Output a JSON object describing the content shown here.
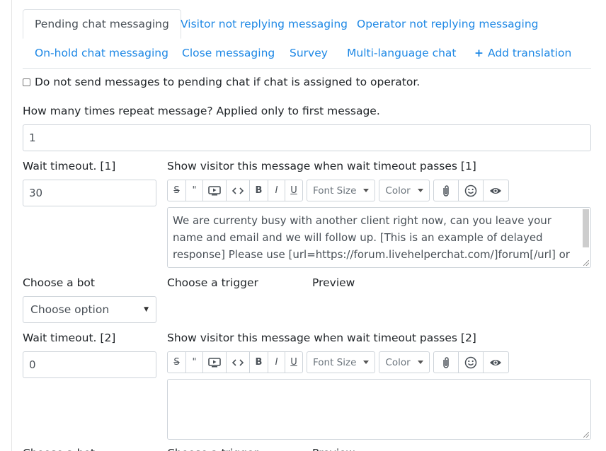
{
  "tabs": [
    {
      "label": "Pending chat messaging",
      "active": true
    },
    {
      "label": "Visitor not replying messaging"
    },
    {
      "label": "Operator not replying messaging"
    },
    {
      "label": "On-hold chat messaging"
    },
    {
      "label": "Close messaging"
    },
    {
      "label": "Survey"
    },
    {
      "label": "Multi-language chat"
    },
    {
      "label": "Add translation",
      "icon": "plus-icon"
    }
  ],
  "checkbox": {
    "label": "Do not send messages to pending chat if chat is assigned to operator.",
    "checked": false
  },
  "repeat": {
    "label": "How many times repeat message? Applied only to first message.",
    "value": "1"
  },
  "toolbar": {
    "strike": "S",
    "quote": "\"",
    "bold": "B",
    "italic": "I",
    "underline": "U",
    "font_size": "Font Size",
    "color": "Color",
    "icons": [
      "strikethrough-icon",
      "quote-icon",
      "video-icon",
      "code-icon",
      "bold-icon",
      "italic-icon",
      "underline-icon",
      "attachment-icon",
      "emoji-icon",
      "preview-eye-icon"
    ]
  },
  "step1": {
    "timeout_label": "Wait timeout. [1]",
    "timeout_value": "30",
    "message_label": "Show visitor this message when wait timeout passes [1]",
    "message_text": "We are currenty busy with another client right now, can you leave your name and email and we will follow up. [This is an example of delayed response] Please use [url=https://forum.livehelperchat.com/]forum[/url] or",
    "bot_label": "Choose a bot",
    "trigger_label": "Choose a trigger",
    "preview_label": "Preview",
    "bot_select": "Choose option"
  },
  "step2": {
    "timeout_label": "Wait timeout. [2]",
    "timeout_value": "0",
    "message_label": "Show visitor this message when wait timeout passes [2]",
    "message_text": ""
  }
}
